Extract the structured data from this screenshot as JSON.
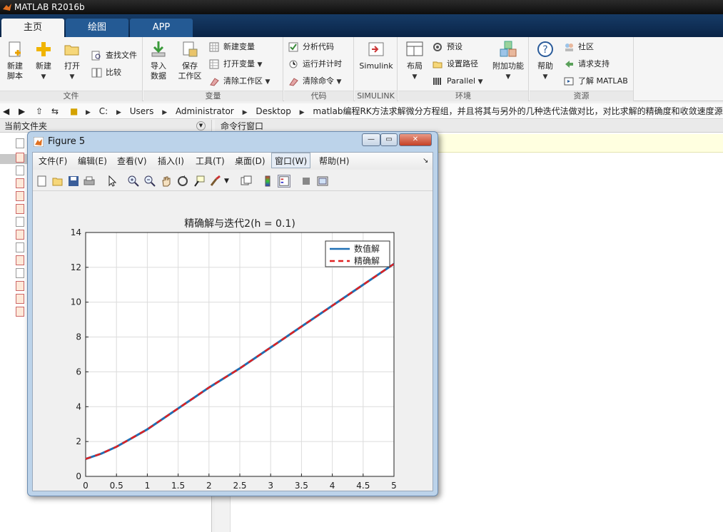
{
  "window": {
    "title": "MATLAB R2016b"
  },
  "tabs": [
    {
      "label": "主页",
      "active": true
    },
    {
      "label": "绘图",
      "active": false
    },
    {
      "label": "APP",
      "active": false
    }
  ],
  "ribbon": {
    "file": {
      "new_script": "新建\n脚本",
      "new_script_l1": "新建",
      "new_script_l2": "脚本",
      "new": "新建",
      "open": "打开",
      "find_files": "查找文件",
      "compare": "比较",
      "group": "文件"
    },
    "variable": {
      "import_l1": "导入",
      "import_l2": "数据",
      "save_l1": "保存",
      "save_l2": "工作区",
      "new_var": "新建变量",
      "open_var": "打开变量",
      "clear_ws": "清除工作区",
      "group": "变量"
    },
    "code": {
      "analyze": "分析代码",
      "run_time": "运行并计时",
      "clear_cmd": "清除命令",
      "group": "代码"
    },
    "simulink": {
      "label": "Simulink",
      "group": "SIMULINK"
    },
    "env": {
      "layout": "布局",
      "prefs": "预设",
      "set_path": "设置路径",
      "parallel": "Parallel",
      "addons": "附加功能",
      "group": "环境"
    },
    "resources": {
      "help": "帮助",
      "community": "社区",
      "support": "请求支持",
      "learn": "了解 MATLAB",
      "group": "资源"
    }
  },
  "address": {
    "crumbs": [
      "C:",
      "Users",
      "Administrator",
      "Desktop",
      "matlab编程RK方法求解微分方程组，并且将其与另外的几种迭代法做对比，对比求解的精确度和收敛速度源码程序"
    ]
  },
  "panels": {
    "current_folder": "当前文件夹",
    "command_window": "命令行窗口"
  },
  "figure": {
    "title": "Figure 5",
    "menu": [
      "文件(F)",
      "编辑(E)",
      "查看(V)",
      "插入(I)",
      "工具(T)",
      "桌面(D)",
      "窗口(W)",
      "帮助(H)"
    ]
  },
  "chart_data": {
    "type": "line",
    "title": "精确解与迭代2(h = 0.1)",
    "xlabel": "",
    "ylabel": "",
    "xlim": [
      0,
      5
    ],
    "ylim": [
      0,
      14
    ],
    "xticks": [
      "0",
      "0.5",
      "1",
      "1.5",
      "2",
      "2.5",
      "3",
      "3.5",
      "4",
      "4.5",
      "5"
    ],
    "yticks": [
      "0",
      "2",
      "4",
      "6",
      "8",
      "10",
      "12",
      "14"
    ],
    "grid": true,
    "legend_position": "top-right",
    "x": [
      0,
      0.25,
      0.5,
      0.75,
      1,
      1.25,
      1.5,
      1.75,
      2,
      2.5,
      3,
      3.5,
      4,
      4.5,
      5
    ],
    "series": [
      {
        "name": "数值解",
        "color": "#1f6fb4",
        "style": "solid",
        "values": [
          1.0,
          1.3,
          1.7,
          2.2,
          2.7,
          3.3,
          3.9,
          4.5,
          5.1,
          6.2,
          7.4,
          8.6,
          9.8,
          11.0,
          12.2
        ]
      },
      {
        "name": "精确解",
        "color": "#e02020",
        "style": "dashed",
        "values": [
          1.0,
          1.3,
          1.7,
          2.2,
          2.7,
          3.3,
          3.9,
          4.5,
          5.1,
          6.2,
          7.4,
          8.6,
          9.8,
          11.0,
          12.2
        ]
      }
    ]
  }
}
